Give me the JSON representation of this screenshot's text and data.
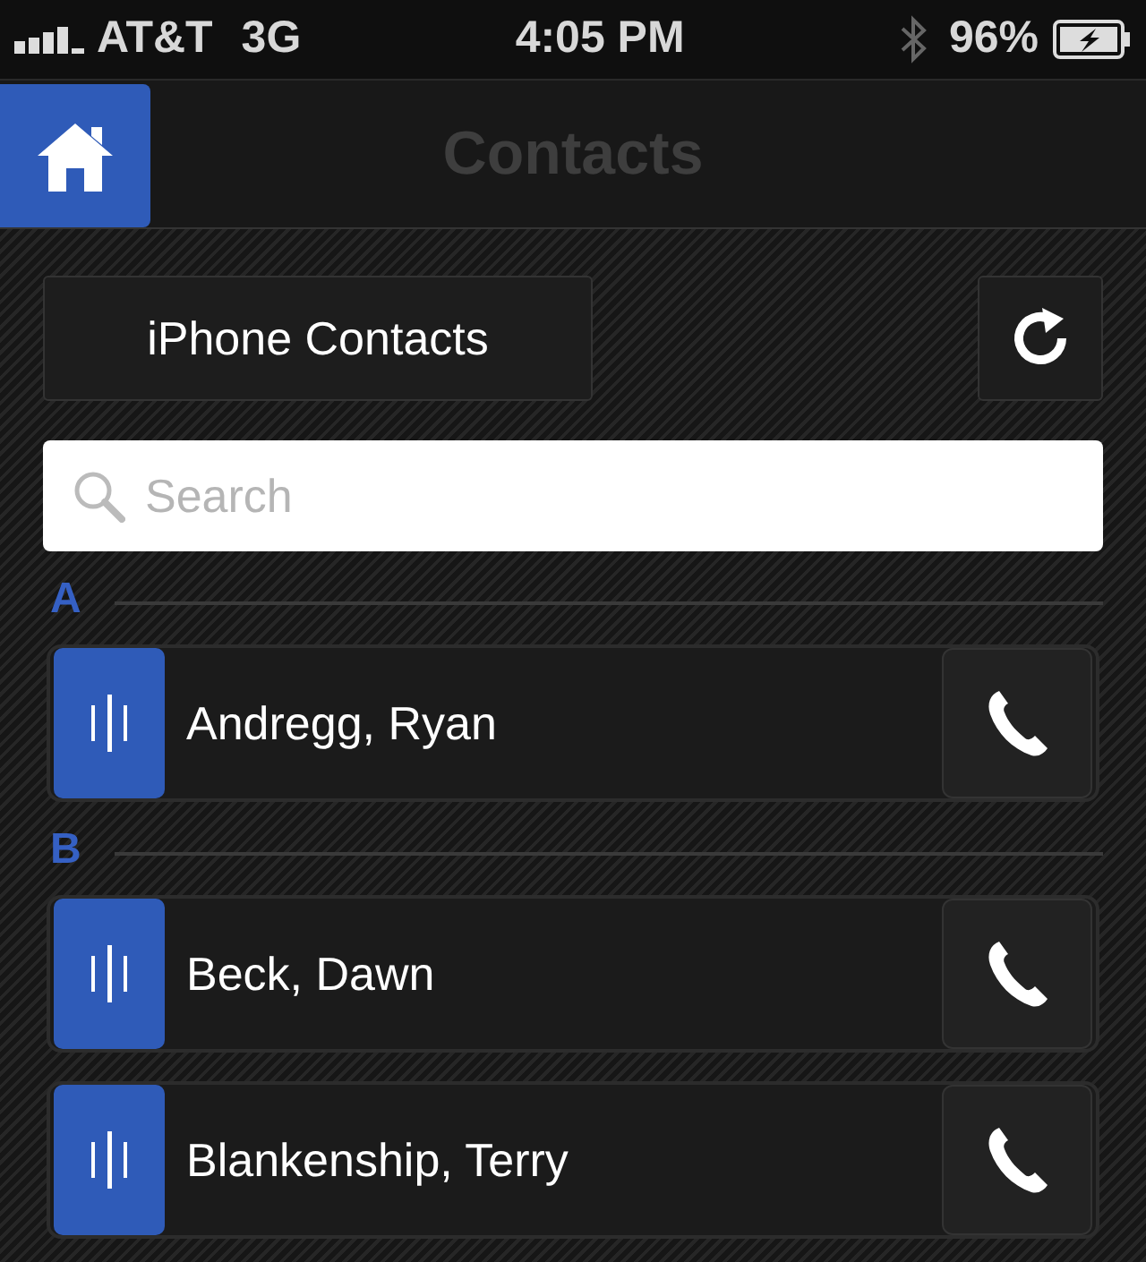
{
  "status_bar": {
    "carrier": "AT&T",
    "network": "3G",
    "time": "4:05 PM",
    "battery": "96%"
  },
  "nav_bar": {
    "title": "Contacts"
  },
  "source_button": {
    "label": "iPhone Contacts"
  },
  "search": {
    "placeholder": "Search"
  },
  "sections": [
    {
      "letter": "A",
      "contacts": [
        {
          "name": "Andregg, Ryan"
        }
      ]
    },
    {
      "letter": "B",
      "contacts": [
        {
          "name": "Beck, Dawn"
        },
        {
          "name": "Blankenship, Terry"
        }
      ]
    }
  ]
}
